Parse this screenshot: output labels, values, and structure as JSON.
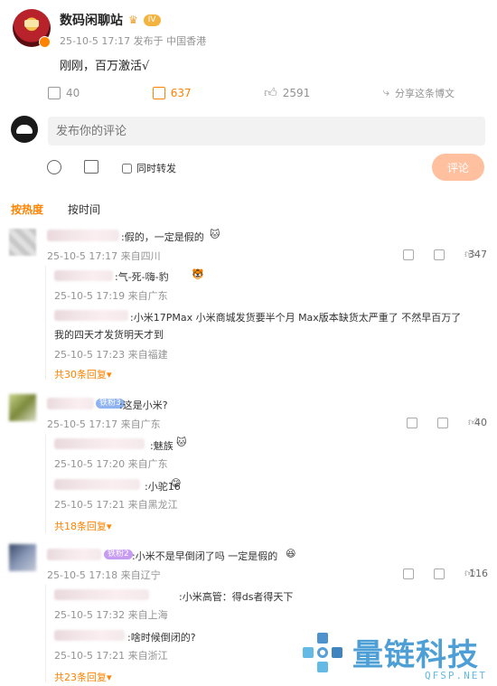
{
  "post": {
    "author": "数码闲聊站",
    "level_badge": "IV",
    "meta": "25-10-5 17:17 发布于 中国香港",
    "text": "刚刚，百万激活√",
    "actions": {
      "repost": "40",
      "comment": "637",
      "like": "2591",
      "share": "分享这条博文"
    }
  },
  "compose": {
    "placeholder": "发布你的评论",
    "repost_label": "同时转发",
    "submit_label": "评论"
  },
  "sort": {
    "hot": "按热度",
    "time": "按时间"
  },
  "comments": [
    {
      "text": ":假的，一定是假的",
      "meta": "25-10-5 17:17 来自四川",
      "likes": "347",
      "replies": [
        {
          "text": ":气-死-嗨-豹",
          "meta": "25-10-5 17:19 来自广东"
        },
        {
          "text": ":小米17PMax  小米商城发货要半个月 Max版本缺货太严重了 不然早百万了",
          "text2": "我的四天才发货明天才到",
          "meta": "25-10-5 17:23 来自福建"
        }
      ],
      "more": "共30条回复"
    },
    {
      "text": ":这是小米?",
      "meta": "25-10-5 17:17 来自广东",
      "likes": "40",
      "badge": "铁粉3",
      "replies": [
        {
          "text": ":魅族",
          "meta": "25-10-5 17:20 来自广东"
        },
        {
          "text": ":小驼16",
          "meta": "25-10-5 17:21 来自黑龙江"
        }
      ],
      "more": "共18条回复"
    },
    {
      "text": ":小米不是早倒闭了吗 一定是假的",
      "meta": "25-10-5 17:18 来自辽宁",
      "likes": "116",
      "badge": "铁粉2",
      "replies": [
        {
          "text": ":小米高管：得ds者得天下",
          "meta": "25-10-5 17:32 来自上海"
        },
        {
          "text": ":啥时候倒闭的?",
          "meta": "25-10-5 17:21 来自浙江"
        }
      ],
      "more": "共23条回复"
    }
  ],
  "watermark": {
    "cn": "量链科技",
    "en": "QFSP.NET"
  },
  "colors": {
    "accent": "#ff8200",
    "button": "#ffc09f",
    "muted": "#939393"
  }
}
